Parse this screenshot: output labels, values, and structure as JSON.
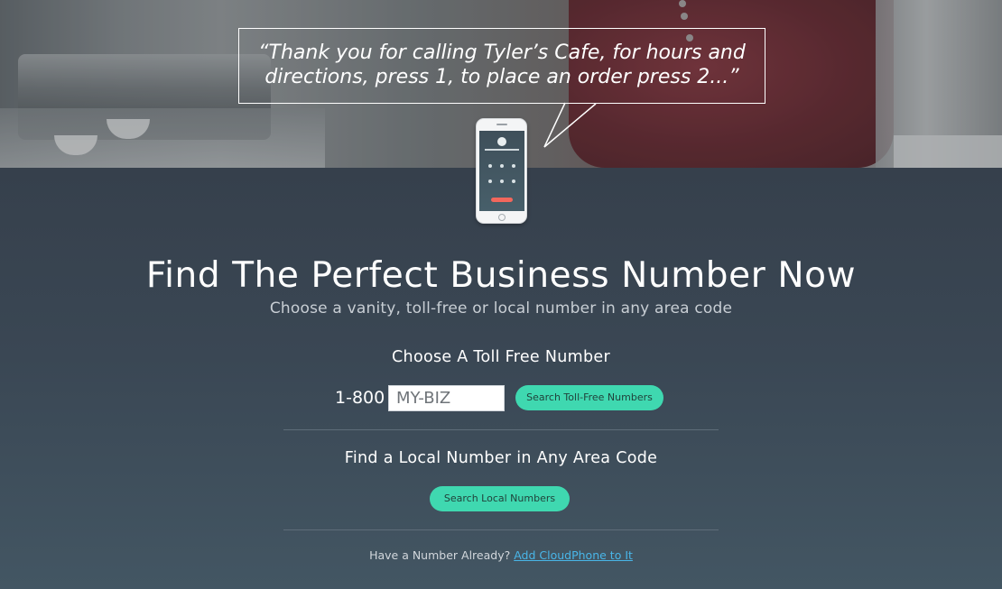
{
  "hero": {
    "quote_line1": "“Thank you for calling Tyler’s Cafe, for hours and",
    "quote_line2": "directions, press 1, to place an order press 2...”"
  },
  "headline": "Find The Perfect Business Number Now",
  "subhead": "Choose a vanity, toll-free or local number in any area code",
  "toll_free": {
    "title": "Choose A Toll Free Number",
    "prefix": "1-800",
    "placeholder": "MY-BIZ",
    "button_label": "Search Toll-Free Numbers"
  },
  "local": {
    "title": "Find a Local Number in Any Area Code",
    "button_label": "Search Local Numbers"
  },
  "footer": {
    "text": "Have a Number Already?",
    "link_label": "Add CloudPhone to It"
  },
  "colors": {
    "accent": "#3fd8b0",
    "link": "#49b6e8",
    "background": "#3a4754",
    "end_call": "#f2675c"
  }
}
